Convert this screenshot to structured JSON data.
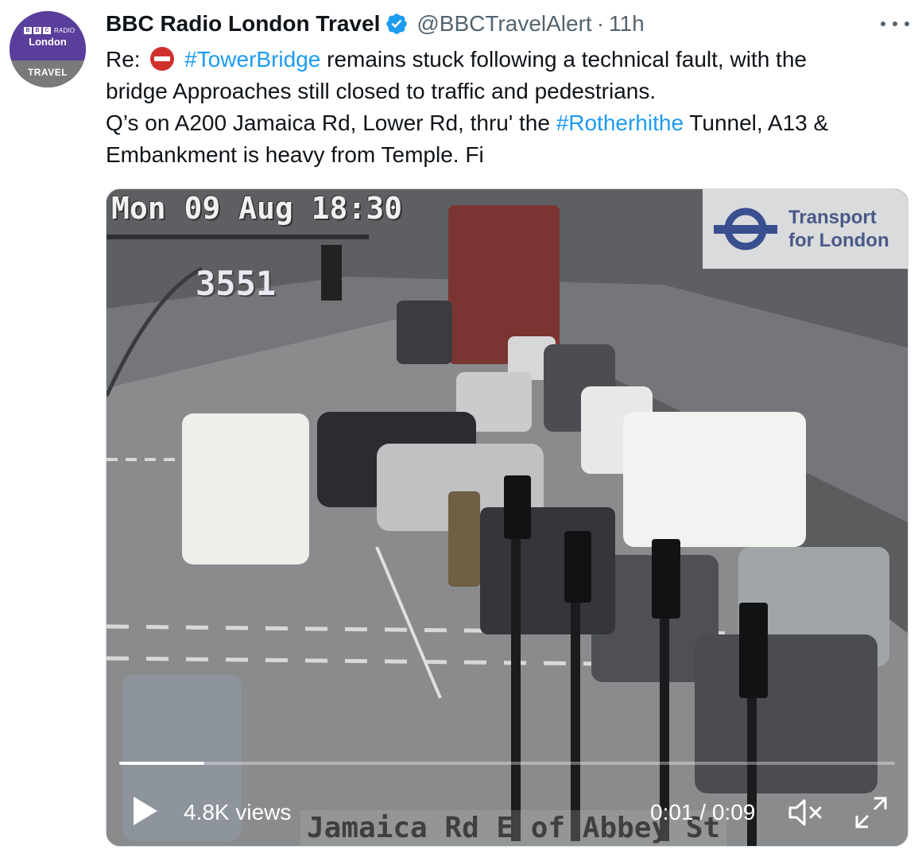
{
  "tweet": {
    "avatar": {
      "bbc_letters": [
        "B",
        "B",
        "C"
      ],
      "radio_label": "RADIO",
      "station": "London",
      "section": "TRAVEL"
    },
    "display_name": "BBC Radio London Travel",
    "handle": "@BBCTravelAlert",
    "separator": "·",
    "time": "11h",
    "verified": true,
    "text": {
      "line1_prefix": "Re: ",
      "hashtag_tower_bridge": "#TowerBridge",
      "line1_suffix": " remains stuck following a technical fault, with the",
      "line2": "bridge Approaches still closed to traffic and pedestrians.",
      "line3_prefix": "Q’s on A200 Jamaica Rd, Lower Rd, thru' the ",
      "hashtag_rotherhithe": "#Rotherhithe",
      "line3_suffix": " Tunnel, A13 &",
      "line4": "Embankment is heavy from Temple. Fi"
    }
  },
  "media": {
    "overlay_datetime": "Mon 09 Aug 18:30",
    "camera_id": "3551",
    "operator_line1": "Transport",
    "operator_line2": "for London",
    "location_caption": "Jamaica Rd E of Abbey St",
    "progress_fraction": 0.11
  },
  "player": {
    "views": "4.8K views",
    "current_time": "0:01",
    "time_separator": " / ",
    "duration": "0:09"
  },
  "colors": {
    "link": "#1d9bf0",
    "text": "#0f1419",
    "muted": "#536471",
    "verified": "#1d9bf0",
    "avatar_purple": "#5a3e9b",
    "tfl_blue": "#4a5a87"
  },
  "icons": [
    "verified-badge-icon",
    "no-entry-icon",
    "more-options-icon",
    "play-icon",
    "mute-icon",
    "fullscreen-icon",
    "tfl-roundel-icon"
  ]
}
